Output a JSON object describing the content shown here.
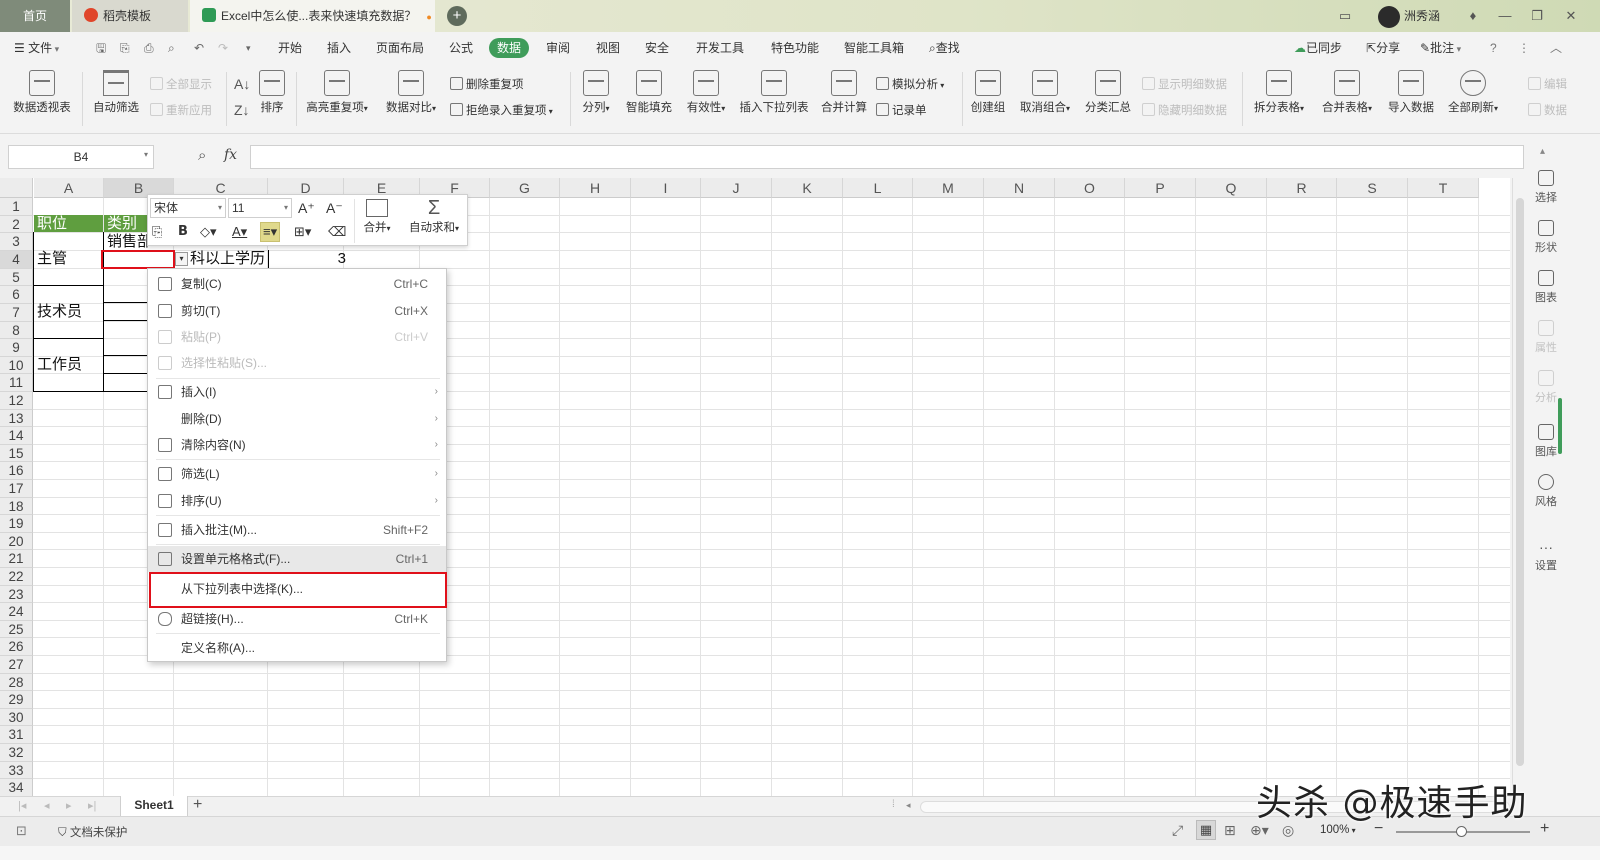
{
  "tabs": {
    "home": "首页",
    "template": "稻壳模板",
    "document": "Excel中怎么使...表来快速填充数据？",
    "new_tab": "+"
  },
  "window": {
    "user": "洲秀涵"
  },
  "menubar": {
    "file": "文件",
    "items": [
      "开始",
      "插入",
      "页面布局",
      "公式",
      "数据",
      "审阅",
      "视图",
      "安全",
      "开发工具",
      "特色功能",
      "智能工具箱"
    ],
    "active": "数据",
    "search": "查找",
    "sync": "已同步",
    "share": "分享",
    "comment": "批注"
  },
  "ribbon": {
    "pivot": "数据透视表",
    "autofilter": "自动筛选",
    "show_all": "全部显示",
    "reapply": "重新应用",
    "sort": "排序",
    "highlight_dup": "高亮重复项",
    "compare": "数据对比",
    "remove_dup": "删除重复项",
    "reject_dup": "拒绝录入重复项",
    "split": "分列",
    "smart_fill": "智能填充",
    "validity": "有效性",
    "insert_dropdown": "插入下拉列表",
    "consolidate": "合并计算",
    "simulate": "模拟分析",
    "record": "记录单",
    "create_group": "创建组",
    "ungroup": "取消组合",
    "subtotal": "分类汇总",
    "show_detail": "显示明细数据",
    "hide_detail": "隐藏明细数据",
    "split_table": "拆分表格",
    "merge_table": "合并表格",
    "import_data": "导入数据",
    "refresh_all": "全部刷新",
    "edit": "编辑",
    "data": "数据"
  },
  "formula_bar": {
    "name_box": "B4",
    "fx": "fx",
    "value": ""
  },
  "grid": {
    "columns": [
      "A",
      "B",
      "C",
      "D",
      "E",
      "F",
      "G",
      "H",
      "I",
      "J",
      "K",
      "L",
      "M",
      "N",
      "O",
      "P",
      "Q",
      "R",
      "S",
      "T"
    ],
    "rows": [
      "1",
      "2",
      "3",
      "4",
      "5",
      "6",
      "7",
      "8",
      "9",
      "10",
      "11",
      "12",
      "13",
      "14",
      "15",
      "16",
      "17",
      "18",
      "19",
      "20",
      "21",
      "22",
      "23",
      "24",
      "25",
      "26",
      "27",
      "28",
      "29",
      "30",
      "31",
      "32",
      "33",
      "34"
    ],
    "cells": {
      "A2": "职位",
      "B2": "类别",
      "B3": "销售部",
      "C4": "科以上学历",
      "D4": "3",
      "A4": "主管",
      "A7": "技术员",
      "A10": "工作员"
    }
  },
  "mini_toolbar": {
    "font": "宋体",
    "size": "11",
    "merge": "合并",
    "autosum": "自动求和"
  },
  "context_menu": [
    {
      "label": "复制(C)",
      "shortcut": "Ctrl+C",
      "disabled": false
    },
    {
      "label": "剪切(T)",
      "shortcut": "Ctrl+X",
      "disabled": false
    },
    {
      "label": "粘贴(P)",
      "shortcut": "Ctrl+V",
      "disabled": true
    },
    {
      "label": "选择性粘贴(S)...",
      "shortcut": "",
      "disabled": true
    },
    {
      "label": "插入(I)",
      "shortcut": "",
      "disabled": false
    },
    {
      "label": "删除(D)",
      "shortcut": "",
      "disabled": false
    },
    {
      "label": "清除内容(N)",
      "shortcut": "",
      "disabled": false
    },
    {
      "label": "筛选(L)",
      "shortcut": "",
      "disabled": false
    },
    {
      "label": "排序(U)",
      "shortcut": "",
      "disabled": false
    },
    {
      "label": "插入批注(M)...",
      "shortcut": "Shift+F2",
      "disabled": false
    },
    {
      "label": "设置单元格格式(F)...",
      "shortcut": "Ctrl+1",
      "disabled": false
    },
    {
      "label": "从下拉列表中选择(K)...",
      "shortcut": "",
      "disabled": false
    },
    {
      "label": "超链接(H)...",
      "shortcut": "Ctrl+K",
      "disabled": false
    },
    {
      "label": "定义名称(A)...",
      "shortcut": "",
      "disabled": false
    }
  ],
  "right_sidebar": [
    "选择",
    "形状",
    "图表",
    "属性",
    "分析",
    "图库",
    "风格",
    "设置"
  ],
  "sheets": {
    "active": "Sheet1",
    "add": "+"
  },
  "statusbar": {
    "protect": "文档未保护",
    "zoom": "100%"
  },
  "watermark": "头杀 @极速手助",
  "colors": {
    "accent": "#3f9c5a",
    "header_fill": "#5f9e3f",
    "highlight": "#e0101a"
  }
}
